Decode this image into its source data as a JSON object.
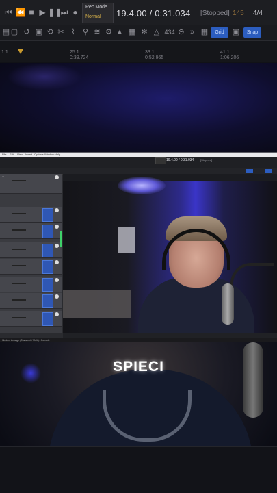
{
  "top": {
    "rec_mode_label": "Rec Mode",
    "rec_mode_value": "Normal",
    "counter": "19.4.00 / 0:31.034",
    "status": "[Stopped]",
    "bpm": "145",
    "meter": "4/4",
    "toolbar": {
      "icon_value": "434",
      "grid_label": "Grid",
      "snap_label": "Snap"
    },
    "timeline": {
      "marker1_bar": "1.1",
      "marker2_bar": "25.1",
      "marker2_time": "0:39.724",
      "marker3_bar": "33.1",
      "marker3_time": "0:52.965",
      "marker4_bar": "41.1",
      "marker4_time": "1:06.206"
    }
  },
  "daw": {
    "menu": [
      "File",
      "Edit",
      "View",
      "Insert",
      "Options",
      "Window",
      "Help"
    ],
    "counter": "19.4.00 / 0:31.034",
    "status": "[Stopped]",
    "footer": "Hidden: Arrange (Transport / Multi) / Console"
  },
  "caption": "SPIECI"
}
